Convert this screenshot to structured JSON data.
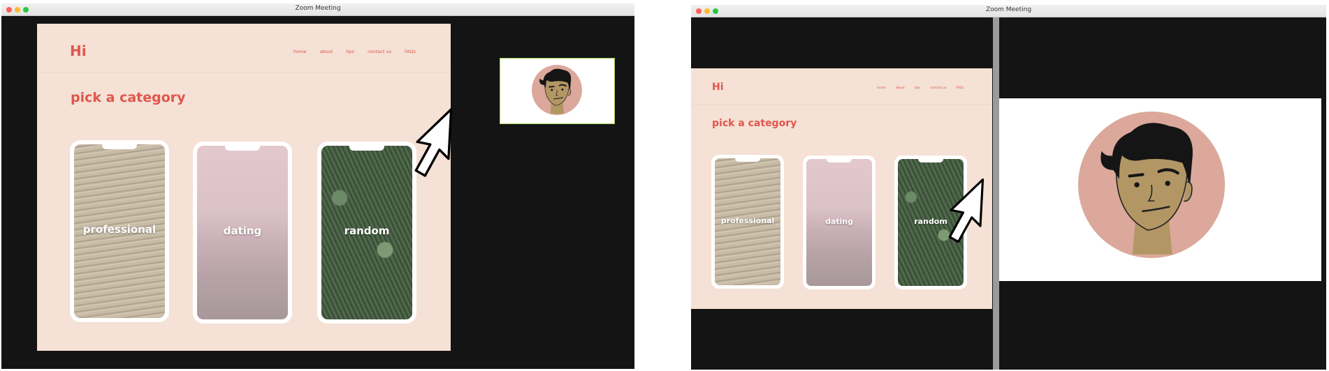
{
  "left_window": {
    "title": "Zoom Meeting",
    "site": {
      "logo": "Hi",
      "nav": [
        "home",
        "about",
        "tips",
        "contact us",
        "FAQs"
      ],
      "heading": "pick a category",
      "categories": [
        "professional",
        "dating",
        "random"
      ]
    },
    "participant_icon": "man-avatar-icon"
  },
  "right_window": {
    "title": "Zoom Meeting",
    "site": {
      "logo": "Hi",
      "nav": [
        "home",
        "about",
        "tips",
        "contact us",
        "FAQs"
      ],
      "heading": "pick a category",
      "categories": [
        "professional",
        "dating",
        "random"
      ]
    },
    "participant_icon": "man-avatar-icon"
  },
  "colors": {
    "brand_red": "#e0564c",
    "site_background": "#f5e1d5",
    "window_background": "#141414",
    "avatar_circle": "#dba89b",
    "skin": "#b29664",
    "hair": "#151515",
    "active_speaker_border": "#a8d04a"
  },
  "pointer_icon": "arrow-cursor-icon"
}
